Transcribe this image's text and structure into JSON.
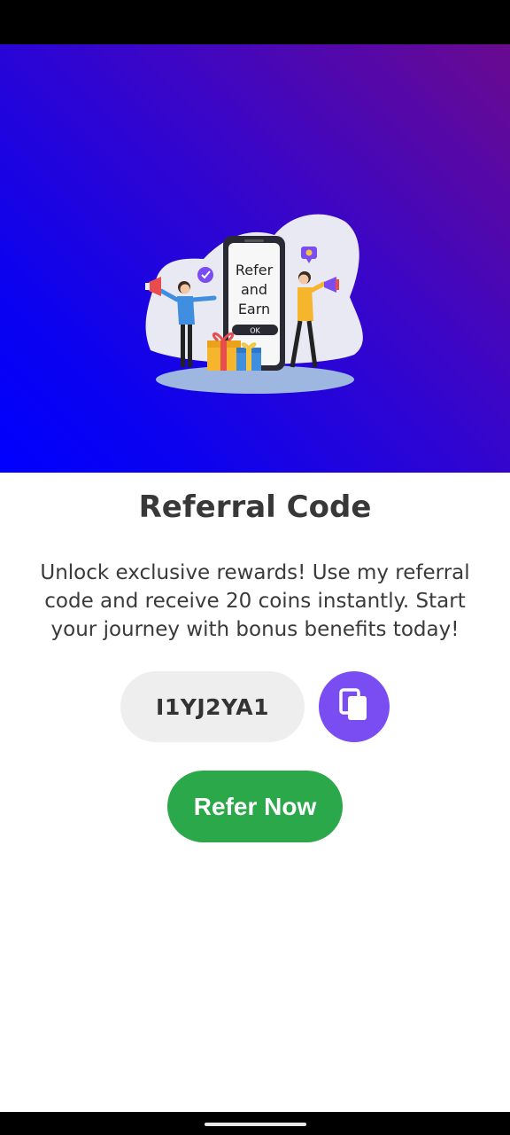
{
  "hero": {
    "illustration": {
      "phone_line1": "Refer",
      "phone_line2": "and",
      "phone_line3": "Earn",
      "phone_button": "OK"
    },
    "gradient_colors": [
      "#0000ff",
      "#3a06c8",
      "#6a0a8e"
    ]
  },
  "title": "Referral Code",
  "description": "Unlock exclusive rewards! Use my referral code and receive 20 coins instantly. Start your journey with bonus benefits today!",
  "referral_code": "I1YJ2YA1",
  "copy_button": {
    "icon": "copy-icon",
    "color": "#7a4df2"
  },
  "refer_button": {
    "label": "Refer Now",
    "color": "#2aa84a"
  }
}
